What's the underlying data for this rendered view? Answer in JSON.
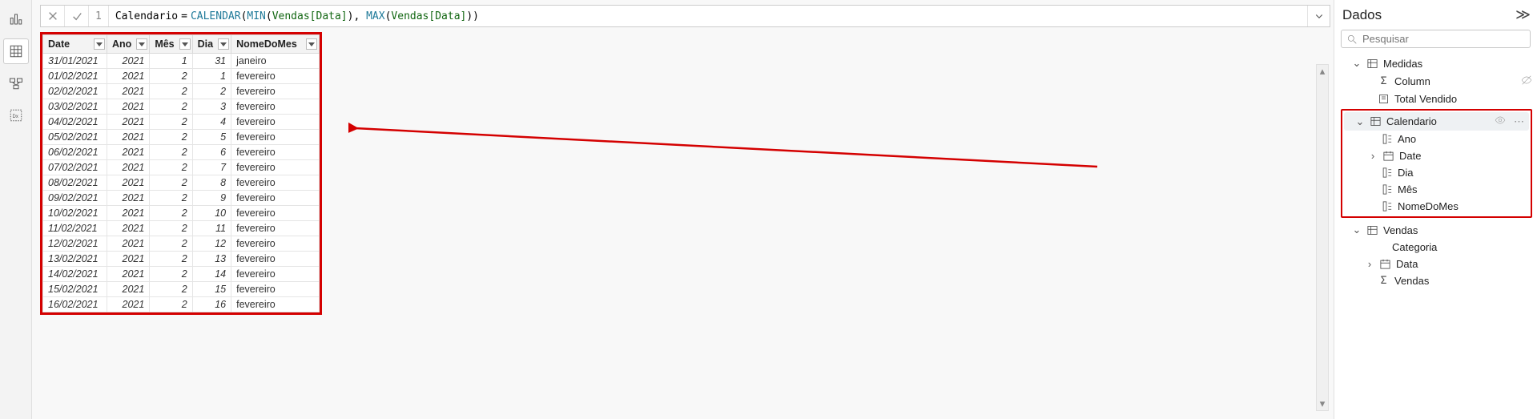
{
  "formula": {
    "line_no": "1",
    "ident": "Calendario",
    "eq": "=",
    "f1": "CALENDAR",
    "p1": "(",
    "f2": "MIN",
    "p2": "(",
    "c1": "Vendas[Data]",
    "p3": ")",
    "comma": ", ",
    "f3": "MAX",
    "p4": "(",
    "c2": "Vendas[Data]",
    "p5": ")",
    "p6": ")"
  },
  "columns": [
    "Date",
    "Ano",
    "Mês",
    "Dia",
    "NomeDoMes"
  ],
  "rows": [
    {
      "date": "31/01/2021",
      "ano": "2021",
      "mes": "1",
      "dia": "31",
      "nome": "janeiro"
    },
    {
      "date": "01/02/2021",
      "ano": "2021",
      "mes": "2",
      "dia": "1",
      "nome": "fevereiro"
    },
    {
      "date": "02/02/2021",
      "ano": "2021",
      "mes": "2",
      "dia": "2",
      "nome": "fevereiro"
    },
    {
      "date": "03/02/2021",
      "ano": "2021",
      "mes": "2",
      "dia": "3",
      "nome": "fevereiro"
    },
    {
      "date": "04/02/2021",
      "ano": "2021",
      "mes": "2",
      "dia": "4",
      "nome": "fevereiro"
    },
    {
      "date": "05/02/2021",
      "ano": "2021",
      "mes": "2",
      "dia": "5",
      "nome": "fevereiro"
    },
    {
      "date": "06/02/2021",
      "ano": "2021",
      "mes": "2",
      "dia": "6",
      "nome": "fevereiro"
    },
    {
      "date": "07/02/2021",
      "ano": "2021",
      "mes": "2",
      "dia": "7",
      "nome": "fevereiro"
    },
    {
      "date": "08/02/2021",
      "ano": "2021",
      "mes": "2",
      "dia": "8",
      "nome": "fevereiro"
    },
    {
      "date": "09/02/2021",
      "ano": "2021",
      "mes": "2",
      "dia": "9",
      "nome": "fevereiro"
    },
    {
      "date": "10/02/2021",
      "ano": "2021",
      "mes": "2",
      "dia": "10",
      "nome": "fevereiro"
    },
    {
      "date": "11/02/2021",
      "ano": "2021",
      "mes": "2",
      "dia": "11",
      "nome": "fevereiro"
    },
    {
      "date": "12/02/2021",
      "ano": "2021",
      "mes": "2",
      "dia": "12",
      "nome": "fevereiro"
    },
    {
      "date": "13/02/2021",
      "ano": "2021",
      "mes": "2",
      "dia": "13",
      "nome": "fevereiro"
    },
    {
      "date": "14/02/2021",
      "ano": "2021",
      "mes": "2",
      "dia": "14",
      "nome": "fevereiro"
    },
    {
      "date": "15/02/2021",
      "ano": "2021",
      "mes": "2",
      "dia": "15",
      "nome": "fevereiro"
    },
    {
      "date": "16/02/2021",
      "ano": "2021",
      "mes": "2",
      "dia": "16",
      "nome": "fevereiro"
    }
  ],
  "side": {
    "title": "Dados",
    "search_placeholder": "Pesquisar",
    "medidas": "Medidas",
    "column": "Column",
    "total_vendido": "Total Vendido",
    "calendario": "Calendario",
    "ano": "Ano",
    "date": "Date",
    "dia": "Dia",
    "mes": "Mês",
    "nomedomes": "NomeDoMes",
    "vendas": "Vendas",
    "categoria": "Categoria",
    "data": "Data",
    "vendas_measure": "Vendas"
  }
}
